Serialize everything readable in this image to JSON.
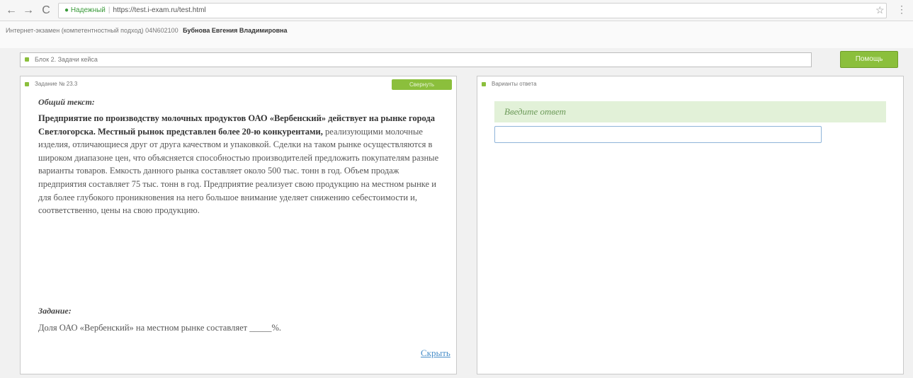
{
  "browser": {
    "back": "←",
    "forward": "→",
    "reload": "C",
    "secure_label": "Надежный",
    "url": "https://test.i-exam.ru/test.html",
    "star": "☆",
    "menu": "⋮"
  },
  "header": {
    "exam_title": "Интернет-экзамен (компетентностный подход) 04N602100",
    "student_name": "Бубнова Евгения Владимировна"
  },
  "block": {
    "label": "Блок 2. Задачи кейса"
  },
  "help_button": "Помощь",
  "task_panel": {
    "title": "Задание № 23.3",
    "hide_button": "Свернуть",
    "common_text_heading": "Общий текст:",
    "common_text_bold": "Предприятие по производству молочных продуктов ОАО «Вербенский» действует на рынке города Светлогорска. Местный рынок представлен более 20-ю конкурентами,",
    "common_text_rest": " реализующими молочные изделия, отличающиеся друг от друга качеством и упаковкой. Сделки на таком рынке осуществляются в широком диапазоне цен, что объясняется способностью производителей предложить покупателям разные варианты товаров. Емкость данного рынка составляет около 500 тыс. тонн в год. Объем продаж предприятия составляет 75 тыс. тонн в год. Предприятие реализует свою продукцию на местном рынке и для более глубокого проникновения на него большое внимание уделяет снижению себестоимости и, соответственно, цены на свою продукцию.",
    "collapse_link": "Скрыть",
    "task_heading": "Задание:",
    "task_text": "Доля ОАО «Вербенский» на местном рынке составляет _____%."
  },
  "answer_panel": {
    "title": "Варианты ответа",
    "hint": "Введите ответ",
    "input_value": ""
  },
  "colors": {
    "accent_green": "#8bbf3c",
    "hint_bg": "#e2f1d8",
    "link_blue": "#4a8fc9"
  }
}
